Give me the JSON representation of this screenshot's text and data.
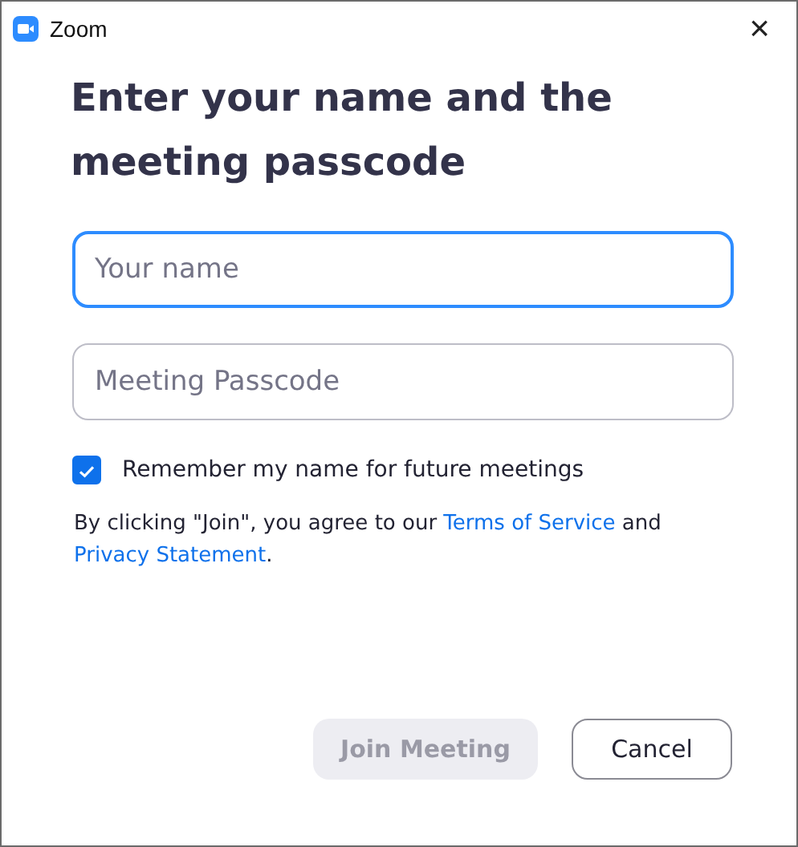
{
  "window": {
    "title": "Zoom",
    "close": "×"
  },
  "heading": "Enter your name and the meeting passcode",
  "fields": [
    {
      "placeholder": "Your name",
      "focused": true
    },
    {
      "placeholder": "Meeting Passcode",
      "focused": false
    }
  ],
  "remember": {
    "label": "Remember my name for future meetings",
    "checked": true
  },
  "legal": {
    "before": "By clicking \"Join\", you agree to our ",
    "terms": "Terms of Service",
    "middle": " and",
    "privacy": "Privacy Statement",
    "after": "."
  },
  "buttons": [
    {
      "label": "Join Meeting",
      "kind": "primary",
      "disabled": true
    },
    {
      "label": "Cancel",
      "kind": "secondary",
      "disabled": false
    }
  ]
}
